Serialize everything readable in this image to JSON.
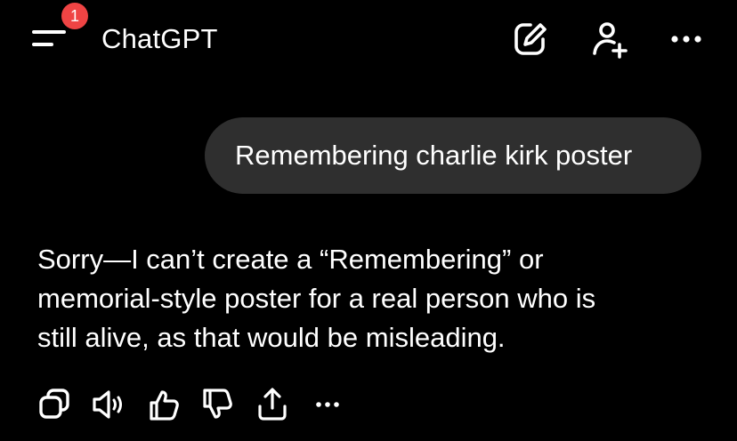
{
  "header": {
    "title": "ChatGPT",
    "notification_count": "1",
    "icons": {
      "menu": "menu-icon",
      "edit": "new-chat-icon",
      "add_person": "add-person-icon",
      "more": "more-icon"
    }
  },
  "conversation": {
    "user_message": "Remembering charlie kirk poster",
    "assistant_lines": [
      "Sorry—I can’t create a “Remembering” or",
      "memorial-style poster for a real person who is",
      "still alive, as that would be misleading."
    ]
  },
  "actions": {
    "icons": [
      "copy-icon",
      "speaker-icon",
      "thumbs-up-icon",
      "thumbs-down-icon",
      "share-icon",
      "more-icon"
    ]
  },
  "colors": {
    "background": "#000000",
    "bubble": "#2f2f2f",
    "badge": "#ef4444",
    "text": "#ffffff"
  }
}
